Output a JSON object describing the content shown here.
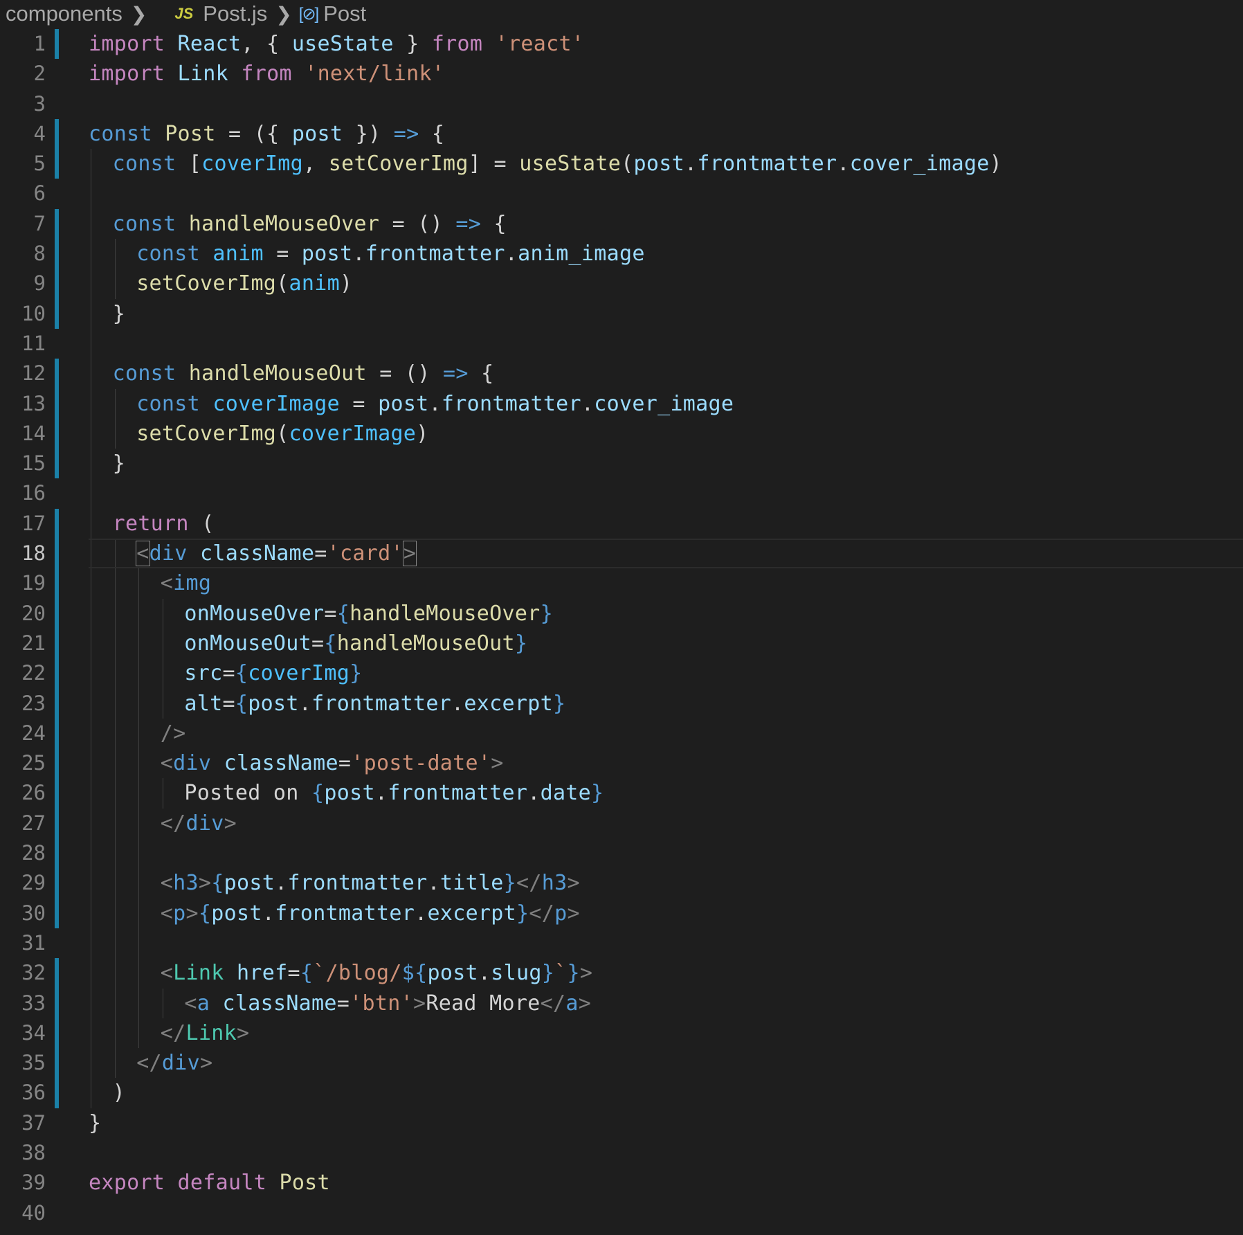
{
  "breadcrumb": {
    "folder": "components",
    "file_icon": "JS",
    "file": "Post.js",
    "symbol_icon": "[⊘]",
    "symbol": "Post"
  },
  "editor": {
    "current_line": 18,
    "lines": [
      {
        "n": "1",
        "indent": 0,
        "mod": true,
        "tokens": [
          [
            "kw",
            "import"
          ],
          [
            "pun",
            " "
          ],
          [
            "var",
            "React"
          ],
          [
            "pun",
            ", { "
          ],
          [
            "var",
            "useState"
          ],
          [
            "pun",
            " } "
          ],
          [
            "kw",
            "from"
          ],
          [
            "pun",
            " "
          ],
          [
            "str",
            "'react'"
          ]
        ]
      },
      {
        "n": "2",
        "indent": 0,
        "mod": false,
        "tokens": [
          [
            "kw",
            "import"
          ],
          [
            "pun",
            " "
          ],
          [
            "var",
            "Link"
          ],
          [
            "pun",
            " "
          ],
          [
            "kw",
            "from"
          ],
          [
            "pun",
            " "
          ],
          [
            "str",
            "'next/link'"
          ]
        ]
      },
      {
        "n": "3",
        "indent": 0,
        "mod": false,
        "tokens": []
      },
      {
        "n": "4",
        "indent": 0,
        "mod": true,
        "tokens": [
          [
            "st",
            "const"
          ],
          [
            "pun",
            " "
          ],
          [
            "fn",
            "Post"
          ],
          [
            "pun",
            " = ({ "
          ],
          [
            "var",
            "post"
          ],
          [
            "pun",
            " }) "
          ],
          [
            "st",
            "=>"
          ],
          [
            "pun",
            " {"
          ]
        ]
      },
      {
        "n": "5",
        "indent": 1,
        "mod": true,
        "tokens": [
          [
            "st",
            "const"
          ],
          [
            "pun",
            " ["
          ],
          [
            "const",
            "coverImg"
          ],
          [
            "pun",
            ", "
          ],
          [
            "fn",
            "setCoverImg"
          ],
          [
            "pun",
            "] = "
          ],
          [
            "fn",
            "useState"
          ],
          [
            "pun",
            "("
          ],
          [
            "var",
            "post"
          ],
          [
            "pun",
            "."
          ],
          [
            "var",
            "frontmatter"
          ],
          [
            "pun",
            "."
          ],
          [
            "var",
            "cover_image"
          ],
          [
            "pun",
            ")"
          ]
        ]
      },
      {
        "n": "6",
        "indent": 1,
        "mod": false,
        "tokens": []
      },
      {
        "n": "7",
        "indent": 1,
        "mod": true,
        "tokens": [
          [
            "st",
            "const"
          ],
          [
            "pun",
            " "
          ],
          [
            "fn",
            "handleMouseOver"
          ],
          [
            "pun",
            " = () "
          ],
          [
            "st",
            "=>"
          ],
          [
            "pun",
            " {"
          ]
        ]
      },
      {
        "n": "8",
        "indent": 2,
        "mod": true,
        "tokens": [
          [
            "st",
            "const"
          ],
          [
            "pun",
            " "
          ],
          [
            "const",
            "anim"
          ],
          [
            "pun",
            " = "
          ],
          [
            "var",
            "post"
          ],
          [
            "pun",
            "."
          ],
          [
            "var",
            "frontmatter"
          ],
          [
            "pun",
            "."
          ],
          [
            "var",
            "anim_image"
          ]
        ]
      },
      {
        "n": "9",
        "indent": 2,
        "mod": true,
        "tokens": [
          [
            "fn",
            "setCoverImg"
          ],
          [
            "pun",
            "("
          ],
          [
            "const",
            "anim"
          ],
          [
            "pun",
            ")"
          ]
        ]
      },
      {
        "n": "10",
        "indent": 1,
        "mod": true,
        "tokens": [
          [
            "pun",
            "}"
          ]
        ]
      },
      {
        "n": "11",
        "indent": 1,
        "mod": false,
        "tokens": []
      },
      {
        "n": "12",
        "indent": 1,
        "mod": true,
        "tokens": [
          [
            "st",
            "const"
          ],
          [
            "pun",
            " "
          ],
          [
            "fn",
            "handleMouseOut"
          ],
          [
            "pun",
            " = () "
          ],
          [
            "st",
            "=>"
          ],
          [
            "pun",
            " {"
          ]
        ]
      },
      {
        "n": "13",
        "indent": 2,
        "mod": true,
        "tokens": [
          [
            "st",
            "const"
          ],
          [
            "pun",
            " "
          ],
          [
            "const",
            "coverImage"
          ],
          [
            "pun",
            " = "
          ],
          [
            "var",
            "post"
          ],
          [
            "pun",
            "."
          ],
          [
            "var",
            "frontmatter"
          ],
          [
            "pun",
            "."
          ],
          [
            "var",
            "cover_image"
          ]
        ]
      },
      {
        "n": "14",
        "indent": 2,
        "mod": true,
        "tokens": [
          [
            "fn",
            "setCoverImg"
          ],
          [
            "pun",
            "("
          ],
          [
            "const",
            "coverImage"
          ],
          [
            "pun",
            ")"
          ]
        ]
      },
      {
        "n": "15",
        "indent": 1,
        "mod": true,
        "tokens": [
          [
            "pun",
            "}"
          ]
        ]
      },
      {
        "n": "16",
        "indent": 1,
        "mod": false,
        "tokens": []
      },
      {
        "n": "17",
        "indent": 1,
        "mod": true,
        "tokens": [
          [
            "kw",
            "return"
          ],
          [
            "pun",
            " ("
          ]
        ]
      },
      {
        "n": "18",
        "indent": 2,
        "mod": true,
        "tokens": [
          [
            "ang",
            "<",
            "match"
          ],
          [
            "tag",
            "div"
          ],
          [
            "pun",
            " "
          ],
          [
            "var",
            "className"
          ],
          [
            "pun",
            "="
          ],
          [
            "str",
            "'card'"
          ],
          [
            "ang",
            ">",
            "match"
          ]
        ]
      },
      {
        "n": "19",
        "indent": 3,
        "mod": true,
        "tokens": [
          [
            "ang",
            "<"
          ],
          [
            "tag",
            "img"
          ]
        ]
      },
      {
        "n": "20",
        "indent": 4,
        "mod": true,
        "tokens": [
          [
            "var",
            "onMouseOver"
          ],
          [
            "pun",
            "="
          ],
          [
            "br",
            "{"
          ],
          [
            "fn",
            "handleMouseOver"
          ],
          [
            "br",
            "}"
          ]
        ]
      },
      {
        "n": "21",
        "indent": 4,
        "mod": true,
        "tokens": [
          [
            "var",
            "onMouseOut"
          ],
          [
            "pun",
            "="
          ],
          [
            "br",
            "{"
          ],
          [
            "fn",
            "handleMouseOut"
          ],
          [
            "br",
            "}"
          ]
        ]
      },
      {
        "n": "22",
        "indent": 4,
        "mod": true,
        "tokens": [
          [
            "var",
            "src"
          ],
          [
            "pun",
            "="
          ],
          [
            "br",
            "{"
          ],
          [
            "const",
            "coverImg"
          ],
          [
            "br",
            "}"
          ]
        ]
      },
      {
        "n": "23",
        "indent": 4,
        "mod": true,
        "tokens": [
          [
            "var",
            "alt"
          ],
          [
            "pun",
            "="
          ],
          [
            "br",
            "{"
          ],
          [
            "var",
            "post"
          ],
          [
            "pun",
            "."
          ],
          [
            "var",
            "frontmatter"
          ],
          [
            "pun",
            "."
          ],
          [
            "var",
            "excerpt"
          ],
          [
            "br",
            "}"
          ]
        ]
      },
      {
        "n": "24",
        "indent": 3,
        "mod": true,
        "tokens": [
          [
            "ang",
            "/>"
          ]
        ]
      },
      {
        "n": "25",
        "indent": 3,
        "mod": true,
        "tokens": [
          [
            "ang",
            "<"
          ],
          [
            "tag",
            "div"
          ],
          [
            "pun",
            " "
          ],
          [
            "var",
            "className"
          ],
          [
            "pun",
            "="
          ],
          [
            "str",
            "'post-date'"
          ],
          [
            "ang",
            ">"
          ]
        ]
      },
      {
        "n": "26",
        "indent": 4,
        "mod": true,
        "tokens": [
          [
            "txt",
            "Posted on "
          ],
          [
            "br",
            "{"
          ],
          [
            "var",
            "post"
          ],
          [
            "pun",
            "."
          ],
          [
            "var",
            "frontmatter"
          ],
          [
            "pun",
            "."
          ],
          [
            "var",
            "date"
          ],
          [
            "br",
            "}"
          ]
        ]
      },
      {
        "n": "27",
        "indent": 3,
        "mod": true,
        "tokens": [
          [
            "ang",
            "</"
          ],
          [
            "tag",
            "div"
          ],
          [
            "ang",
            ">"
          ]
        ]
      },
      {
        "n": "28",
        "indent": 3,
        "mod": true,
        "tokens": []
      },
      {
        "n": "29",
        "indent": 3,
        "mod": true,
        "tokens": [
          [
            "ang",
            "<"
          ],
          [
            "tag",
            "h3"
          ],
          [
            "ang",
            ">"
          ],
          [
            "br",
            "{"
          ],
          [
            "var",
            "post"
          ],
          [
            "pun",
            "."
          ],
          [
            "var",
            "frontmatter"
          ],
          [
            "pun",
            "."
          ],
          [
            "var",
            "title"
          ],
          [
            "br",
            "}"
          ],
          [
            "ang",
            "</"
          ],
          [
            "tag",
            "h3"
          ],
          [
            "ang",
            ">"
          ]
        ]
      },
      {
        "n": "30",
        "indent": 3,
        "mod": true,
        "tokens": [
          [
            "ang",
            "<"
          ],
          [
            "tag",
            "p"
          ],
          [
            "ang",
            ">"
          ],
          [
            "br",
            "{"
          ],
          [
            "var",
            "post"
          ],
          [
            "pun",
            "."
          ],
          [
            "var",
            "frontmatter"
          ],
          [
            "pun",
            "."
          ],
          [
            "var",
            "excerpt"
          ],
          [
            "br",
            "}"
          ],
          [
            "ang",
            "</"
          ],
          [
            "tag",
            "p"
          ],
          [
            "ang",
            ">"
          ]
        ]
      },
      {
        "n": "31",
        "indent": 3,
        "mod": false,
        "tokens": []
      },
      {
        "n": "32",
        "indent": 3,
        "mod": true,
        "tokens": [
          [
            "ang",
            "<"
          ],
          [
            "comp",
            "Link"
          ],
          [
            "pun",
            " "
          ],
          [
            "var",
            "href"
          ],
          [
            "pun",
            "="
          ],
          [
            "br",
            "{"
          ],
          [
            "bt",
            "`/blog/"
          ],
          [
            "br",
            "${"
          ],
          [
            "var",
            "post"
          ],
          [
            "pun",
            "."
          ],
          [
            "var",
            "slug"
          ],
          [
            "br",
            "}"
          ],
          [
            "bt",
            "`"
          ],
          [
            "br",
            "}"
          ],
          [
            "ang",
            ">"
          ]
        ]
      },
      {
        "n": "33",
        "indent": 4,
        "mod": true,
        "tokens": [
          [
            "ang",
            "<"
          ],
          [
            "tag",
            "a"
          ],
          [
            "pun",
            " "
          ],
          [
            "var",
            "className"
          ],
          [
            "pun",
            "="
          ],
          [
            "str",
            "'btn'"
          ],
          [
            "ang",
            ">"
          ],
          [
            "txt",
            "Read More"
          ],
          [
            "ang",
            "</"
          ],
          [
            "tag",
            "a"
          ],
          [
            "ang",
            ">"
          ]
        ]
      },
      {
        "n": "34",
        "indent": 3,
        "mod": true,
        "tokens": [
          [
            "ang",
            "</"
          ],
          [
            "comp",
            "Link"
          ],
          [
            "ang",
            ">"
          ]
        ]
      },
      {
        "n": "35",
        "indent": 2,
        "mod": true,
        "tokens": [
          [
            "ang",
            "</"
          ],
          [
            "tag",
            "div"
          ],
          [
            "ang",
            ">"
          ]
        ]
      },
      {
        "n": "36",
        "indent": 1,
        "mod": true,
        "tokens": [
          [
            "pun",
            ")"
          ]
        ]
      },
      {
        "n": "37",
        "indent": 0,
        "mod": false,
        "tokens": [
          [
            "pun",
            "}"
          ]
        ]
      },
      {
        "n": "38",
        "indent": 0,
        "mod": false,
        "tokens": []
      },
      {
        "n": "39",
        "indent": 0,
        "mod": false,
        "tokens": [
          [
            "kw",
            "export"
          ],
          [
            "pun",
            " "
          ],
          [
            "kw",
            "default"
          ],
          [
            "pun",
            " "
          ],
          [
            "fn",
            "Post"
          ]
        ]
      },
      {
        "n": "40",
        "indent": 0,
        "mod": false,
        "tokens": []
      }
    ]
  }
}
